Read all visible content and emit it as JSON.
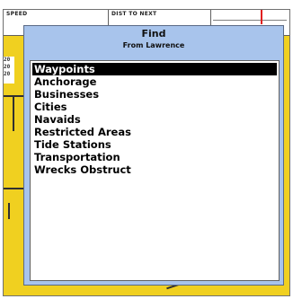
{
  "map": {
    "speed_label": "SPEED",
    "dist_label": "DIST TO NEXT",
    "scale_lines": [
      "20",
      "20",
      "20"
    ]
  },
  "find_dialog": {
    "title": "Find",
    "subtitle": "From Lawrence",
    "items": [
      {
        "label": "Waypoints",
        "selected": true
      },
      {
        "label": "Anchorage",
        "selected": false
      },
      {
        "label": "Businesses",
        "selected": false
      },
      {
        "label": "Cities",
        "selected": false
      },
      {
        "label": "Navaids",
        "selected": false
      },
      {
        "label": "Restricted Areas",
        "selected": false
      },
      {
        "label": "Tide Stations",
        "selected": false
      },
      {
        "label": "Transportation",
        "selected": false
      },
      {
        "label": "Wrecks Obstruct",
        "selected": false
      }
    ]
  },
  "colors": {
    "dialog_background": "#a8c4ec",
    "map_background": "#f0d020",
    "selection_background": "#000000",
    "selection_text": "#ffffff",
    "compass_marker": "#e02020"
  }
}
